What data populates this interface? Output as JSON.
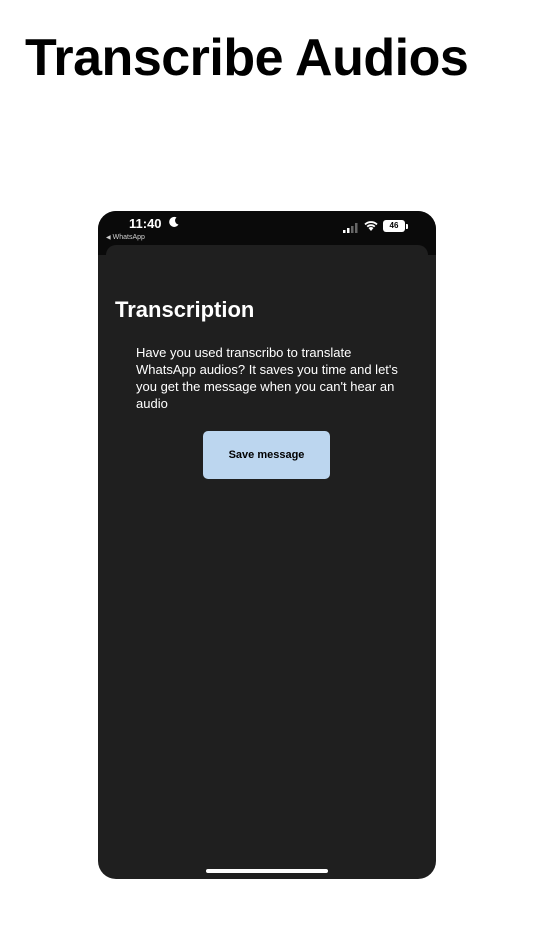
{
  "page": {
    "title": "Transcribe Audios"
  },
  "status_bar": {
    "time": "11:40",
    "back_app": "WhatsApp",
    "battery": "46",
    "icons": [
      "moon-icon",
      "back-arrow-icon",
      "signal-icon",
      "wifi-icon",
      "battery-icon"
    ]
  },
  "screen": {
    "title": "Transcription",
    "description": "Have you used transcribo to translate WhatsApp audios? It saves you time and let's you get the message when you can't hear an audio",
    "save_button": "Save message"
  },
  "colors": {
    "page_background": "#ffffff",
    "phone_background": "#1f1f1f",
    "button_background": "#bcd6ef",
    "text_light": "#ffffff"
  }
}
